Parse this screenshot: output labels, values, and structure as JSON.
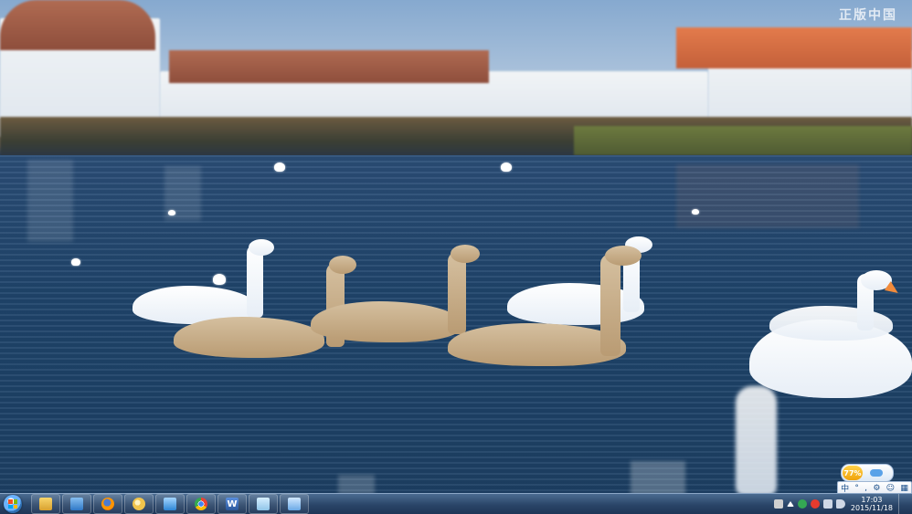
{
  "watermark": {
    "text": "正版中国"
  },
  "desktop": {
    "wallpaper_description_colors": {
      "sky": "#86a9cf",
      "water": "#234b72",
      "roof_red": "#8e4e3c",
      "roof_orange": "#e37b4c"
    }
  },
  "taskbar": {
    "start_button": {
      "icon": "windows-start-orb"
    },
    "pinned_apps": [
      {
        "name": "windows-explorer",
        "icon": "folder-icon",
        "color": "#e2b13c"
      },
      {
        "name": "control-panel",
        "icon": "control-panel-icon",
        "color": "#4d8cd1"
      },
      {
        "name": "firefox",
        "icon": "firefox-icon",
        "color": "#e66000"
      },
      {
        "name": "media-player",
        "icon": "media-icon",
        "color": "#f0c44c"
      },
      {
        "name": "network",
        "icon": "network-icon",
        "color": "#4ca3e0"
      },
      {
        "name": "chrome",
        "icon": "chrome-icon",
        "color": "#34a853"
      },
      {
        "name": "word",
        "icon": "word-icon",
        "color": "#2b579a"
      },
      {
        "name": "notepad",
        "icon": "notepad-icon",
        "color": "#8fc4e8"
      },
      {
        "name": "utility",
        "icon": "utility-icon",
        "color": "#6aa9e6"
      }
    ],
    "tray": {
      "icons": [
        {
          "name": "action-center-icon",
          "color": "#d0d0d0"
        },
        {
          "name": "up-arrow-icon",
          "color": "#ffffff"
        },
        {
          "name": "security-icon",
          "color": "#34a853"
        },
        {
          "name": "app-tray-icon",
          "color": "#e63b2e"
        },
        {
          "name": "network-tray-icon",
          "color": "#cfd8e6"
        },
        {
          "name": "volume-icon",
          "color": "#cfd8e6"
        }
      ],
      "time": "17:03",
      "date": "2015/11/18"
    }
  },
  "weather_widget": {
    "value": "77%"
  },
  "ime_bar": {
    "lang": "中",
    "items": [
      "中",
      "°",
      ",",
      "⚙",
      "☺",
      "▦"
    ]
  }
}
